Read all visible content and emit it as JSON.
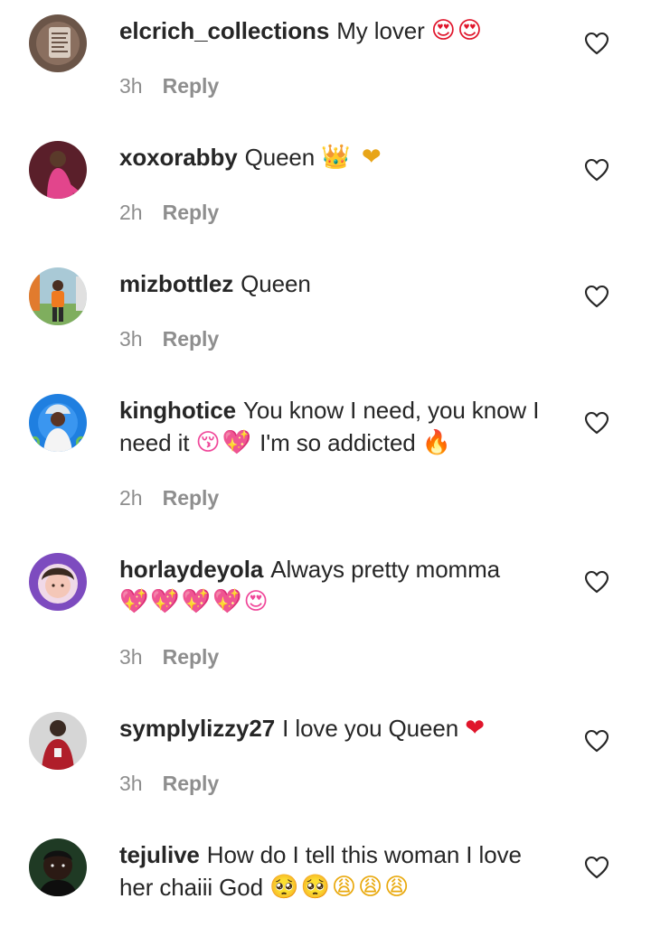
{
  "comments": [
    {
      "username": "elcrich_collections",
      "text": "My lover",
      "emoji": "😍😍",
      "time": "3h",
      "reply": "Reply"
    },
    {
      "username": "xoxorabby",
      "text": "Queen",
      "emoji": "👑 ❤",
      "time": "2h",
      "reply": "Reply"
    },
    {
      "username": "mizbottlez",
      "text": "Queen",
      "emoji": "",
      "time": "3h",
      "reply": "Reply"
    },
    {
      "username": "kinghotice",
      "text": "You know I need, you know I need it",
      "emoji": "😚💖",
      "text2": "I'm so addicted",
      "emoji2": "🔥",
      "time": "2h",
      "reply": "Reply"
    },
    {
      "username": "horlaydeyola",
      "text": "Always pretty momma",
      "emoji": "💖💖💖💖😍",
      "time": "3h",
      "reply": "Reply"
    },
    {
      "username": "symplylizzy27",
      "text": "I love you Queen",
      "emoji": "❤",
      "time": "3h",
      "reply": "Reply"
    },
    {
      "username": "tejulive",
      "text": "How do I tell this woman I love her chaiii God",
      "emoji": "🥺🥺😩😩😩",
      "time": "",
      "reply": ""
    }
  ],
  "icons": {
    "like": "heart-outline-icon",
    "avatar": "user-avatar"
  },
  "colors": {
    "text": "#262626",
    "meta": "#8e8e8e",
    "heart": "#262626"
  }
}
